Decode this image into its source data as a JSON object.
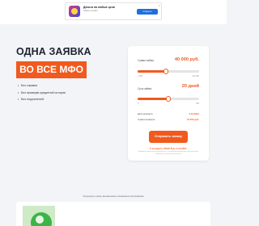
{
  "ad": {
    "icon": "app-logo-icon",
    "title": "Деньги на любые цели",
    "subtitle": "Займы онлайн",
    "button_label": "Открыть",
    "close_glyph": "×"
  },
  "hero": {
    "headline": "ОДНА ЗАЯВКА",
    "badge": "ВО ВСЕ МФО",
    "bullets": [
      "Без справок",
      "Без проверки кредитной истории",
      "Без поручителей"
    ]
  },
  "calculator": {
    "amount_label": "Сумма займа",
    "amount_value": "40 000 руб.",
    "amount_level": 0.46,
    "amount_min": "1 000",
    "amount_max": "100 000",
    "term_label": "Срок займа",
    "term_value": "20 дней",
    "term_level": 0.5,
    "term_min": "5",
    "term_max": "365",
    "return_date_label": "Дата возврата",
    "return_date_value": "2.12.2021",
    "return_sum_label": "Сумма возврата",
    "return_sum_value": "44 000 руб.",
    "submit_label": "Отправить заявку",
    "promo_text": "К возврату 40000 ₽ до 2.12.2021",
    "fine_print": "Нажимая кнопку вы соглашаетесь с условиями обработки персональных данных и получения рассылок"
  },
  "footer": {
    "notice": "Подходите сразу финансовых возможностей вовремя"
  },
  "colors": {
    "accent": "#f05a1e",
    "background": "#f3f4f7",
    "card": "#ffffff"
  }
}
